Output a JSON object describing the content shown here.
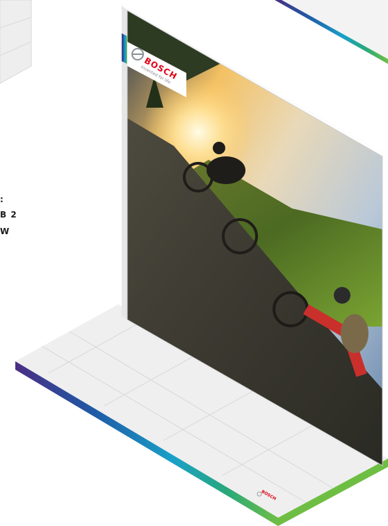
{
  "brand": {
    "name": "BOSCH",
    "tagline": "Invented for life",
    "floor_logo": "BOSCH",
    "brand_red": "#e20015"
  },
  "side_text": {
    "line_1": ":",
    "line_2": "B 2",
    "line_3": "W"
  },
  "colors": {
    "gradient": [
      "#4a2e83",
      "#1f5aa6",
      "#1aa0c8",
      "#27a87c",
      "#6fbe44"
    ],
    "floor": "#efefef",
    "panel_back": "#f2f2f2",
    "grid_line": "#d7d7d7"
  },
  "icons": {
    "logo": "bosch-armature-icon"
  }
}
